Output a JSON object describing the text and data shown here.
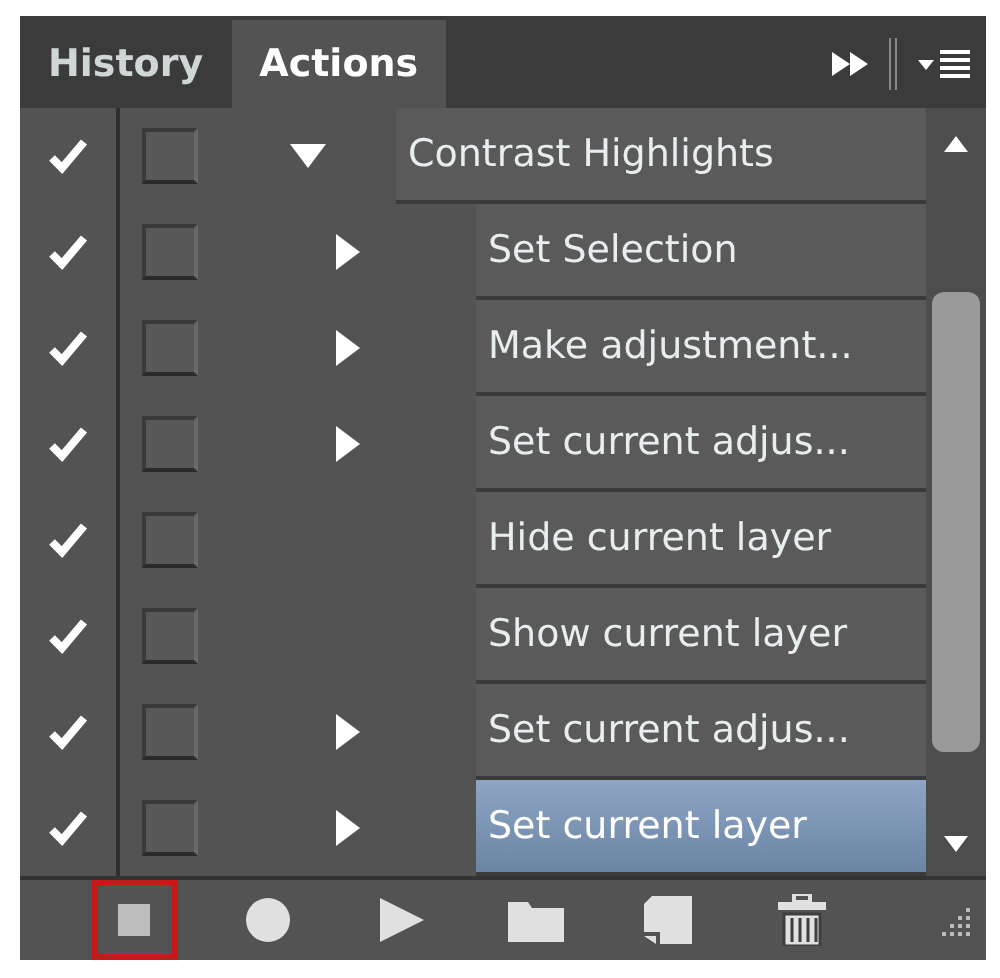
{
  "tabs": [
    {
      "label": "History",
      "selected": false
    },
    {
      "label": "Actions",
      "selected": true
    }
  ],
  "actions": [
    {
      "label": "Contrast Highlights",
      "enabled": true,
      "dialog": false,
      "expanded": true,
      "selected": false,
      "children": [
        {
          "label": "Set Selection",
          "enabled": true,
          "dialog": false,
          "expandable": true,
          "selected": false
        },
        {
          "label": "Make adjustment...",
          "enabled": true,
          "dialog": false,
          "expandable": true,
          "selected": false
        },
        {
          "label": "Set current adjus...",
          "enabled": true,
          "dialog": false,
          "expandable": true,
          "selected": false
        },
        {
          "label": "Hide current layer",
          "enabled": true,
          "dialog": false,
          "expandable": false,
          "selected": false
        },
        {
          "label": "Show current layer",
          "enabled": true,
          "dialog": false,
          "expandable": false,
          "selected": false
        },
        {
          "label": "Set current adjus...",
          "enabled": true,
          "dialog": false,
          "expandable": true,
          "selected": false
        },
        {
          "label": "Set current layer",
          "enabled": true,
          "dialog": false,
          "expandable": true,
          "selected": true
        }
      ]
    }
  ],
  "toolbar": [
    {
      "kind": "stop",
      "highlighted": true
    },
    {
      "kind": "record",
      "highlighted": false
    },
    {
      "kind": "play",
      "highlighted": false
    },
    {
      "kind": "folder",
      "highlighted": false
    },
    {
      "kind": "new",
      "highlighted": false
    },
    {
      "kind": "delete",
      "highlighted": false
    }
  ]
}
